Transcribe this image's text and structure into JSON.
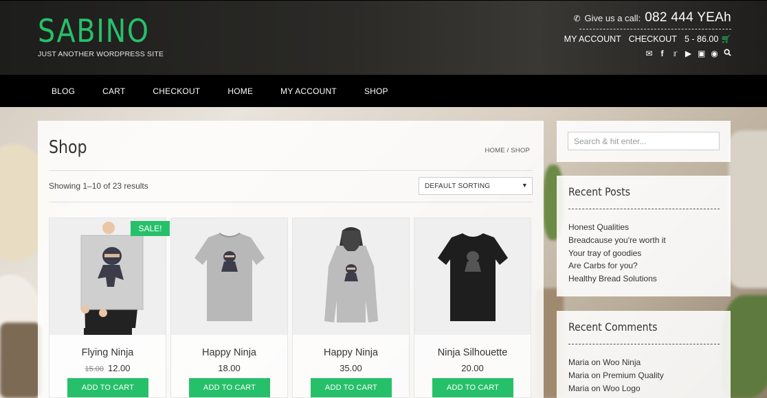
{
  "site": {
    "logo": "SABINO",
    "tagline": "JUST ANOTHER WORDPRESS SITE",
    "call_label": "Give us a call:",
    "phone": "082 444 YEAh",
    "my_account": "MY ACCOUNT",
    "checkout": "CHECKOUT",
    "cart_summary": "5 - 86.00"
  },
  "social_icons": [
    "email-icon",
    "facebook-icon",
    "twitter-icon",
    "youtube-icon",
    "instagram-icon",
    "pinterest-icon",
    "search-icon"
  ],
  "nav": {
    "items": [
      {
        "label": "BLOG"
      },
      {
        "label": "CART"
      },
      {
        "label": "CHECKOUT"
      },
      {
        "label": "HOME"
      },
      {
        "label": "MY ACCOUNT"
      },
      {
        "label": "SHOP"
      }
    ]
  },
  "shop": {
    "title": "Shop",
    "breadcrumb": "HOME / SHOP",
    "result_count": "Showing 1–10 of 23 results",
    "sort_value": "DEFAULT SORTING",
    "products": [
      {
        "name": "Flying Ninja",
        "old_price": "15.00",
        "price": "12.00",
        "sale_badge": "SALE!",
        "button": "ADD TO CART"
      },
      {
        "name": "Happy Ninja",
        "price": "18.00",
        "button": "ADD TO CART"
      },
      {
        "name": "Happy Ninja",
        "price": "35.00",
        "button": "ADD TO CART"
      },
      {
        "name": "Ninja Silhouette",
        "price": "20.00",
        "button": "ADD TO CART"
      }
    ]
  },
  "sidebar": {
    "search_placeholder": "Search & hit enter...",
    "recent_posts_title": "Recent Posts",
    "recent_posts": [
      "Honest Qualities",
      "Breadcause you're worth it",
      "Your tray of goodies",
      "Are Carbs for you?",
      "Healthy Bread Solutions"
    ],
    "recent_comments_title": "Recent Comments",
    "recent_comments": [
      {
        "author": "Maria",
        "on": "on",
        "post": "Woo Ninja"
      },
      {
        "author": "Maria",
        "on": "on",
        "post": "Premium Quality"
      },
      {
        "author": "Maria",
        "on": "on",
        "post": "Woo Logo"
      }
    ]
  },
  "colors": {
    "accent": "#27c06a",
    "header_bg": "#1d1d1b",
    "nav_bg": "#000000"
  }
}
